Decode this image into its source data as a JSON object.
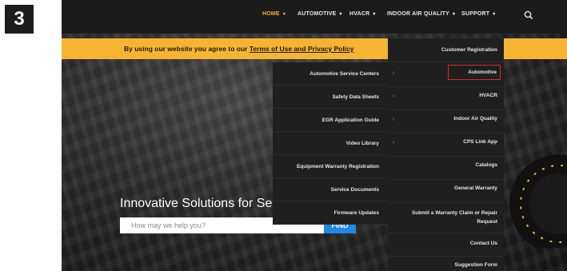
{
  "step_badge": "3",
  "nav": {
    "items": [
      {
        "label": "HOME",
        "active": true
      },
      {
        "label": "AUTOMOTIVE",
        "active": false
      },
      {
        "label": "HVACR",
        "active": false
      },
      {
        "label": "INDOOR AIR QUALITY",
        "active": false
      },
      {
        "label": "SUPPORT",
        "active": false
      }
    ],
    "search_icon": "search-icon"
  },
  "cookie_bar": {
    "text": "By using our website you agree to our",
    "link": "Terms of Use and Privacy Policy"
  },
  "submenu_left": {
    "items": [
      "Automotive Service Centers",
      "Safety Data Sheets",
      "EGR Application Guide",
      "Video Library",
      "Equipment Warranty Registration",
      "Service Documents",
      "Firmware Updates"
    ]
  },
  "submenu_right": {
    "items": [
      "Customer Registration",
      "Automotive",
      "HVACR",
      "Indoor Air Quality",
      "CPS Link App",
      "Catalogs",
      "General Warranty",
      "Submit a Warranty Claim or Repair Request",
      "Contact Us",
      "Suggestion Form"
    ],
    "highlighted": "Automotive"
  },
  "hero": {
    "title": "Innovative Solutions for Serv",
    "search_placeholder": "How may we help you?",
    "find_label": "FIND"
  },
  "colors": {
    "accent": "#f6b432",
    "highlight_border": "#e0262b",
    "find_button": "#1e88e5"
  }
}
